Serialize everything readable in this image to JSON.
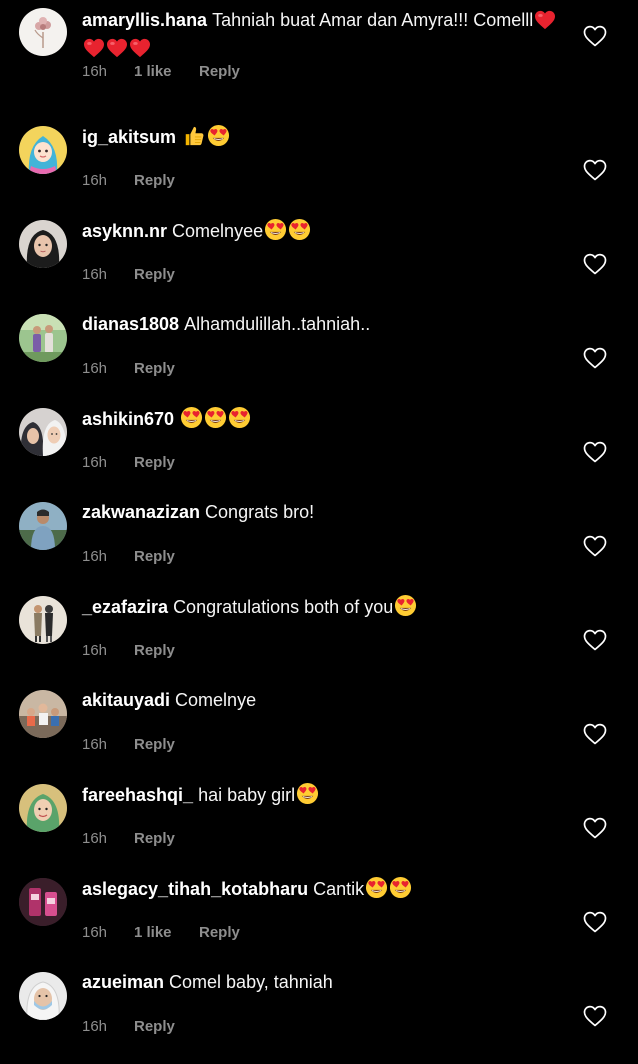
{
  "ui": {
    "reply_label": "Reply",
    "colors": {
      "background": "#000000",
      "text": "#ffffff",
      "meta": "#8e8e8e"
    }
  },
  "comments": [
    {
      "username": "amaryllis.hana",
      "text": "Tahniah buat Amar dan Amyra!!! Comelll",
      "emojis": [
        "red-heart",
        "red-heart",
        "red-heart",
        "red-heart"
      ],
      "time": "16h",
      "likes": "1 like",
      "avatar": "flower-avatar"
    },
    {
      "username": "ig_akitsum",
      "text": "",
      "emojis": [
        "thumbs-up",
        "heart-eyes"
      ],
      "time": "16h",
      "likes": "",
      "avatar": "hijab-cartoon-avatar"
    },
    {
      "username": "asyknn.nr",
      "text": "Comelnyee",
      "emojis": [
        "heart-eyes",
        "heart-eyes"
      ],
      "time": "16h",
      "likes": "",
      "avatar": "person-avatar"
    },
    {
      "username": "dianas1808",
      "text": "Alhamdulillah..tahniah..",
      "emojis": [],
      "time": "16h",
      "likes": "",
      "avatar": "outdoor-couple-avatar"
    },
    {
      "username": "ashikin670",
      "text": "",
      "emojis": [
        "heart-eyes",
        "heart-eyes",
        "heart-eyes"
      ],
      "time": "16h",
      "likes": "",
      "avatar": "two-women-avatar"
    },
    {
      "username": "zakwanazizan",
      "text": "Congrats bro!",
      "emojis": [],
      "time": "16h",
      "likes": "",
      "avatar": "man-outdoor-avatar"
    },
    {
      "username": "_ezafazira",
      "text": "Congratulations both of you",
      "emojis": [
        "heart-eyes"
      ],
      "time": "16h",
      "likes": "",
      "avatar": "couple-standing-avatar"
    },
    {
      "username": "akitauyadi",
      "text": "Comelnye",
      "emojis": [],
      "time": "16h",
      "likes": "",
      "avatar": "group-photo-avatar"
    },
    {
      "username": "fareehashqi_",
      "text": "hai baby girl",
      "emojis": [
        "heart-eyes"
      ],
      "time": "16h",
      "likes": "",
      "avatar": "woman-green-avatar"
    },
    {
      "username": "aslegacy_tihah_kotabharu",
      "text": "Cantik",
      "emojis": [
        "heart-eyes",
        "heart-eyes"
      ],
      "time": "16h",
      "likes": "1 like",
      "avatar": "product-avatar"
    },
    {
      "username": "azueiman",
      "text": "Comel baby, tahniah",
      "emojis": [],
      "time": "16h",
      "likes": "",
      "avatar": "masked-person-avatar"
    }
  ]
}
